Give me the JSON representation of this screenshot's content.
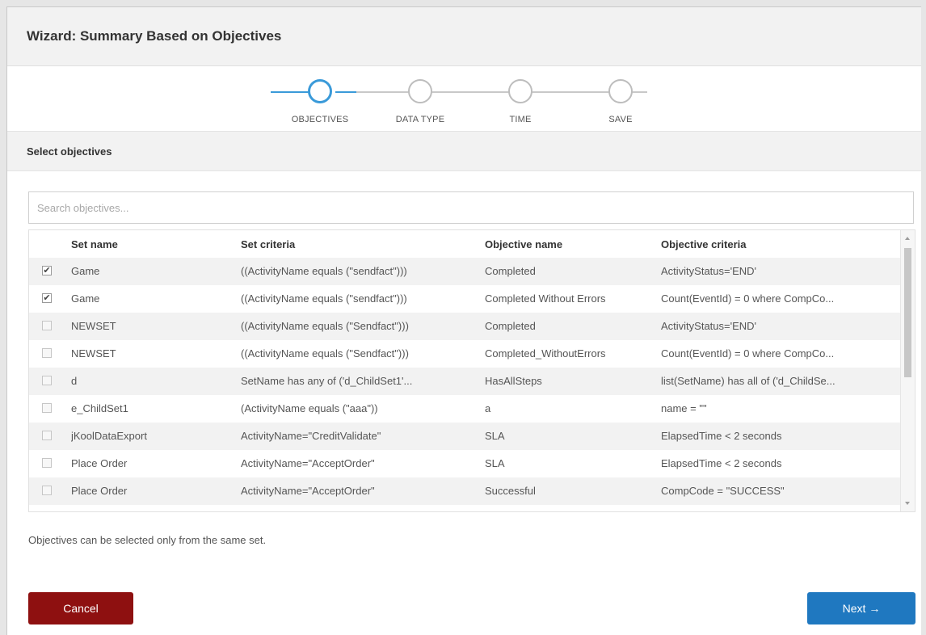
{
  "dialog": {
    "title": "Wizard: Summary Based on Objectives"
  },
  "stepper": {
    "steps": [
      {
        "label": "OBJECTIVES",
        "active": true
      },
      {
        "label": "DATA TYPE",
        "active": false
      },
      {
        "label": "TIME",
        "active": false
      },
      {
        "label": "SAVE",
        "active": false
      }
    ]
  },
  "section": {
    "title": "Select objectives"
  },
  "search": {
    "placeholder": "Search objectives..."
  },
  "table": {
    "headers": [
      "Set name",
      "Set criteria",
      "Objective name",
      "Objective criteria"
    ],
    "rows": [
      {
        "checked": true,
        "set_name": "Game",
        "set_criteria": "((ActivityName equals (\"sendfact\")))",
        "objective_name": "Completed",
        "objective_criteria": "ActivityStatus='END'"
      },
      {
        "checked": true,
        "set_name": "Game",
        "set_criteria": "((ActivityName equals (\"sendfact\")))",
        "objective_name": "Completed Without Errors",
        "objective_criteria": "Count(EventId) = 0 where CompCo..."
      },
      {
        "checked": false,
        "set_name": "NEWSET",
        "set_criteria": "((ActivityName equals (\"Sendfact\")))",
        "objective_name": "Completed",
        "objective_criteria": "ActivityStatus='END'"
      },
      {
        "checked": false,
        "set_name": "NEWSET",
        "set_criteria": "((ActivityName equals (\"Sendfact\")))",
        "objective_name": "Completed_WithoutErrors",
        "objective_criteria": "Count(EventId) = 0 where CompCo..."
      },
      {
        "checked": false,
        "set_name": "d",
        "set_criteria": "SetName has any of ('d_ChildSet1'...",
        "objective_name": "HasAllSteps",
        "objective_criteria": "list(SetName) has all of ('d_ChildSe..."
      },
      {
        "checked": false,
        "set_name": "e_ChildSet1",
        "set_criteria": "(ActivityName equals (\"aaa\"))",
        "objective_name": "a",
        "objective_criteria": "name = \"\""
      },
      {
        "checked": false,
        "set_name": "jKoolDataExport",
        "set_criteria": "ActivityName=\"CreditValidate\"",
        "objective_name": "SLA",
        "objective_criteria": "ElapsedTime < 2 seconds"
      },
      {
        "checked": false,
        "set_name": "Place Order",
        "set_criteria": "ActivityName=\"AcceptOrder\"",
        "objective_name": "SLA",
        "objective_criteria": "ElapsedTime < 2 seconds"
      },
      {
        "checked": false,
        "set_name": "Place Order",
        "set_criteria": "ActivityName=\"AcceptOrder\"",
        "objective_name": "Successful",
        "objective_criteria": "CompCode = \"SUCCESS\""
      }
    ]
  },
  "note": "Objectives can be selected only from the same set.",
  "buttons": {
    "cancel": "Cancel",
    "next": "Next →"
  },
  "colors": {
    "accent": "#3a9ad9",
    "cancel": "#8e1010",
    "next": "#1f78c0"
  }
}
